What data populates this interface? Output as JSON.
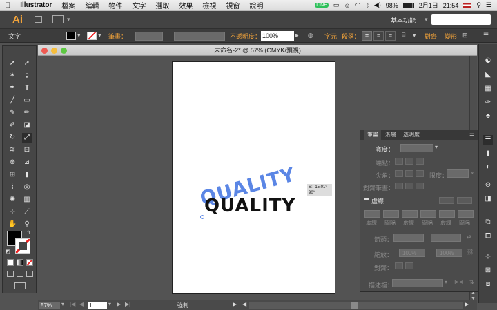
{
  "menubar": {
    "apple": "",
    "items": [
      "Illustrator",
      "檔案",
      "編輯",
      "物件",
      "文字",
      "選取",
      "效果",
      "檢視",
      "視窗",
      "說明"
    ],
    "battery": "98%",
    "date": "2月1日",
    "time": "21:54"
  },
  "appbar": {
    "logo": "Ai",
    "workspace": "基本功能"
  },
  "control": {
    "label": "文字",
    "stroke_label": "筆畫：",
    "opacity_label": "不透明度：",
    "opacity_value": "100%",
    "char_label": "字元",
    "para_label": "段落：",
    "align_label": "對齊",
    "transform_label": "變形"
  },
  "document": {
    "title": "未命名-2* @ 57% (CMYK/預視)",
    "tooltip_line1": "S: -15.01°",
    "tooltip_line2": "90°",
    "text_top": "QUALITY",
    "text_bottom": "QUALITY"
  },
  "status": {
    "zoom": "57%",
    "page": "1",
    "mode": "強制"
  },
  "panel": {
    "tabs": [
      "筆畫",
      "漸層",
      "透明度"
    ],
    "weight_label": "寬度：",
    "cap_label": "端點：",
    "corner_label": "尖角：",
    "limit_label": "限度：",
    "align_label": "對齊筆畫：",
    "dashed_label": "虛線",
    "dash_labels": [
      "虛線",
      "間隔",
      "虛線",
      "間隔",
      "虛線",
      "間隔"
    ],
    "arrow_label": "箭頭：",
    "scale_label": "縮放：",
    "scale_value1": "100%",
    "scale_value2": "100%",
    "align2_label": "對齊：",
    "profile_label": "描述檔："
  },
  "colors": {
    "accent_blue": "#5b86e5",
    "orange": "#f0a23a"
  }
}
